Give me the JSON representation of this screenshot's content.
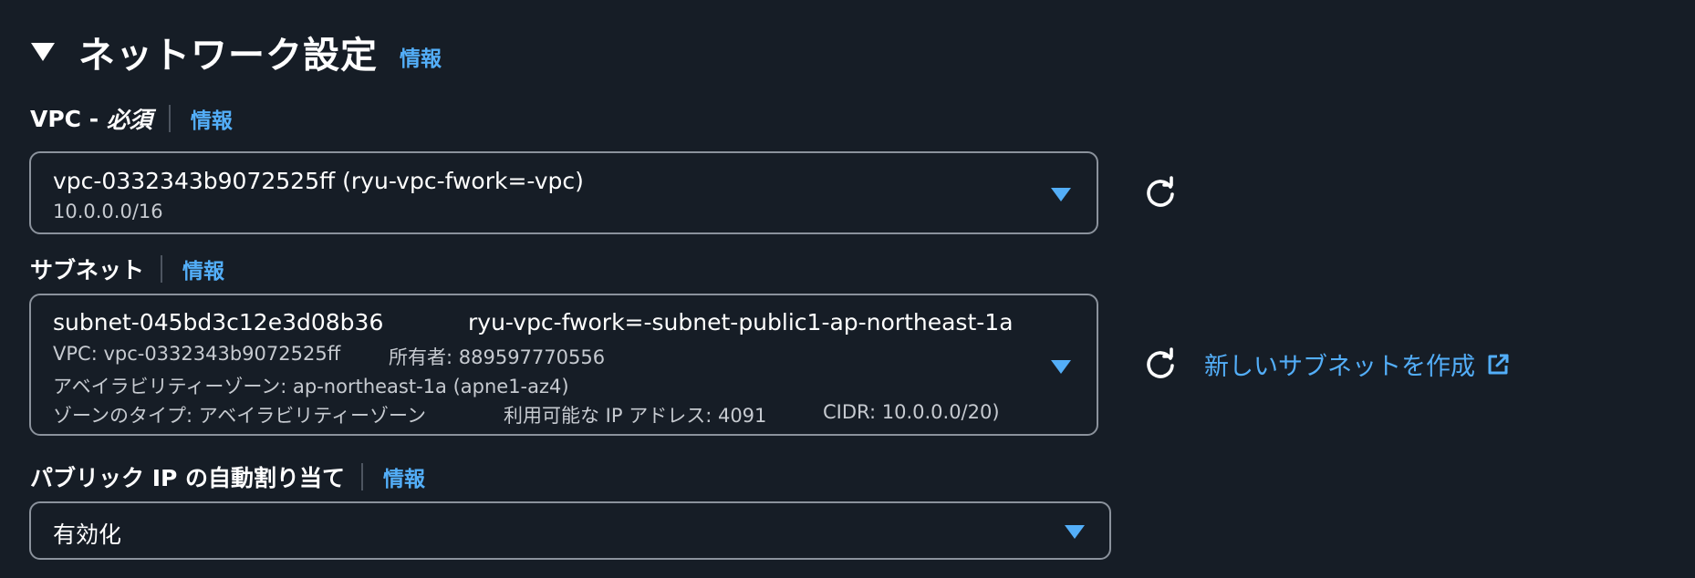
{
  "section": {
    "title": "ネットワーク設定",
    "info_label": "情報"
  },
  "vpc": {
    "label": "VPC - ",
    "label_required": "必須",
    "info_label": "情報",
    "selected_value": "vpc-0332343b9072525ff (ryu-vpc-fwork=-vpc)",
    "selected_subtext": "10.0.0.0/16"
  },
  "subnet": {
    "label": "サブネット",
    "info_label": "情報",
    "selected_id": "subnet-045bd3c12e3d08b36",
    "selected_name": "ryu-vpc-fwork=-subnet-public1-ap-northeast-1a",
    "vpc_text": "VPC: vpc-0332343b9072525ff",
    "owner_text": "所有者: 889597770556",
    "az_text": "アベイラビリティーゾーン: ap-northeast-1a (apne1-az4)",
    "zone_type_text": "ゾーンのタイプ: アベイラビリティーゾーン",
    "available_ip_text": "利用可能な IP アドレス: 4091",
    "cidr_text": "CIDR: 10.0.0.0/20)",
    "create_link_label": "新しいサブネットを作成"
  },
  "public_ip": {
    "label": "パブリック IP の自動割り当て",
    "info_label": "情報",
    "selected_value": "有効化"
  },
  "colors": {
    "background": "#161d26",
    "link": "#53aef8",
    "border": "#8b929c",
    "text": "#ffffff",
    "subtext": "#c6cad0"
  },
  "icons": {
    "collapse": "caret-down-icon",
    "refresh": "refresh-icon",
    "external_link": "external-link-icon",
    "dropdown": "dropdown-arrow-icon"
  }
}
